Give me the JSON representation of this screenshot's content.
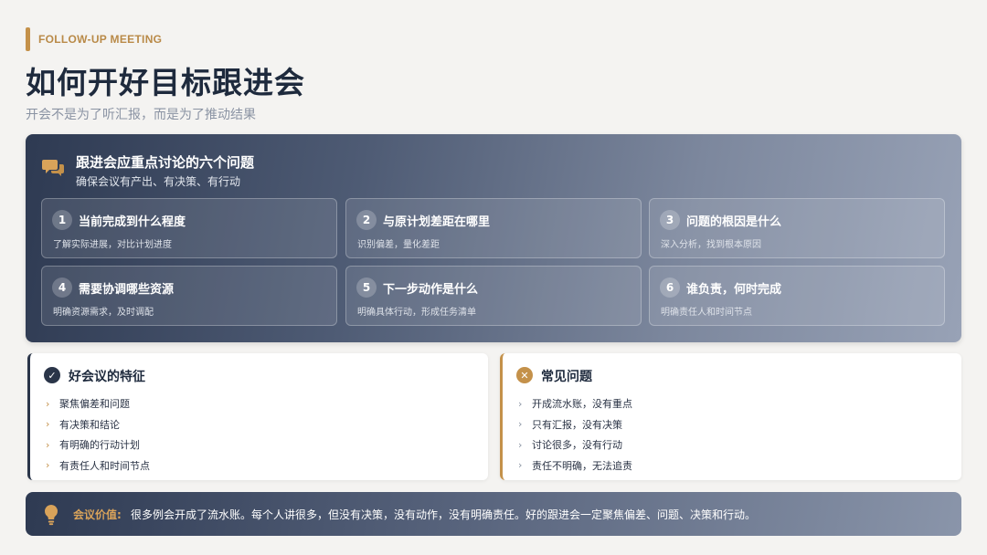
{
  "header": {
    "eyebrow": "FOLLOW-UP MEETING",
    "title": "如何开好目标跟进会",
    "subtitle": "开会不是为了听汇报，而是为了推动结果"
  },
  "panel": {
    "icon": "chat-bubbles-icon",
    "title": "跟进会应重点讨论的六个问题",
    "subtitle": "确保会议有产出、有决策、有行动",
    "cards": [
      {
        "num": "1",
        "title": "当前完成到什么程度",
        "desc": "了解实际进展，对比计划进度"
      },
      {
        "num": "2",
        "title": "与原计划差距在哪里",
        "desc": "识别偏差，量化差距"
      },
      {
        "num": "3",
        "title": "问题的根因是什么",
        "desc": "深入分析，找到根本原因"
      },
      {
        "num": "4",
        "title": "需要协调哪些资源",
        "desc": "明确资源需求，及时调配"
      },
      {
        "num": "5",
        "title": "下一步动作是什么",
        "desc": "明确具体行动，形成任务清单"
      },
      {
        "num": "6",
        "title": "谁负责，何时完成",
        "desc": "明确责任人和时间节点"
      }
    ]
  },
  "good": {
    "icon": "check-circle-icon",
    "title": "好会议的特征",
    "items": [
      "聚焦偏差和问题",
      "有决策和结论",
      "有明确的行动计划",
      "有责任人和时间节点"
    ]
  },
  "bad": {
    "icon": "x-circle-icon",
    "title": "常见问题",
    "items": [
      "开成流水账，没有重点",
      "只有汇报，没有决策",
      "讨论很多，没有行动",
      "责任不明确，无法追责"
    ]
  },
  "bottom": {
    "icon": "lightbulb-icon",
    "label": "会议价值:",
    "text": "很多例会开成了流水账。每个人讲很多，但没有决策，没有动作，没有明确责任。好的跟进会一定聚焦偏差、问题、决策和行动。"
  },
  "colors": {
    "accent_gold": "#c4914a",
    "navy": "#2a3549"
  }
}
